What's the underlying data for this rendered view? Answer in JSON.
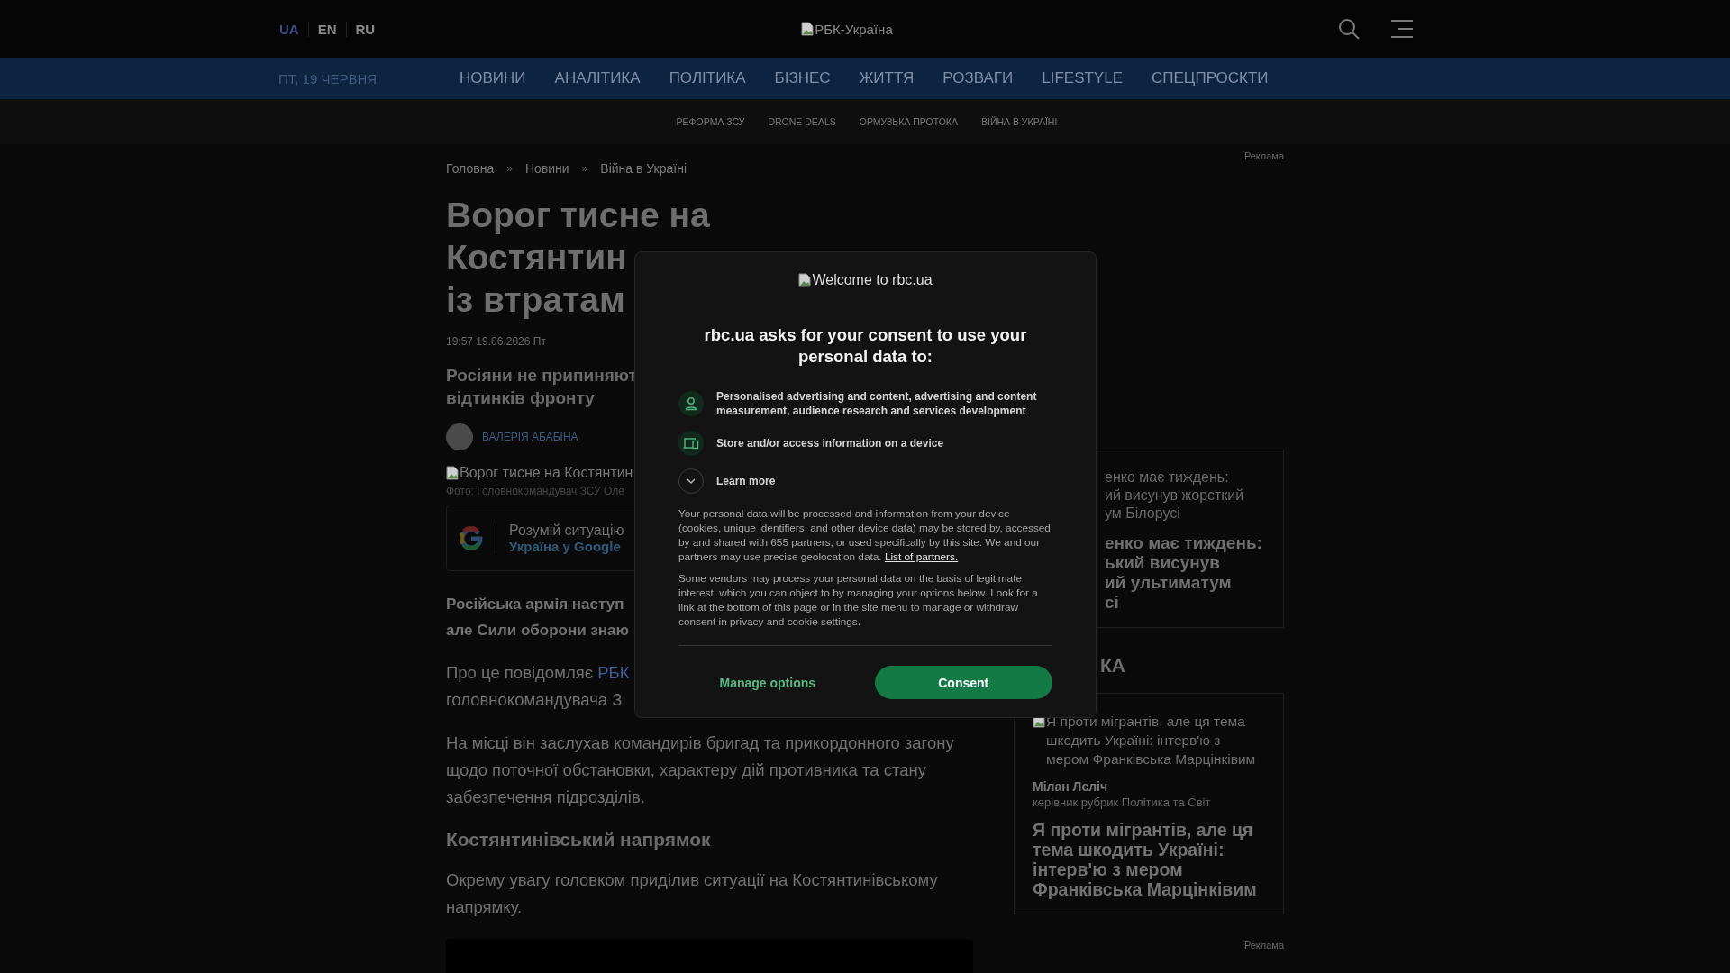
{
  "header": {
    "languages": [
      {
        "label": "UA",
        "selected": true
      },
      {
        "label": "EN",
        "selected": false
      },
      {
        "label": "RU",
        "selected": false
      }
    ],
    "logo_alt": "РБК-Україна"
  },
  "nav": {
    "date": "ПТ, 19 ЧЕРВНЯ",
    "items": [
      "НОВИНИ",
      "АНАЛІТИКА",
      "ПОЛІТИКА",
      "БІЗНЕС",
      "ЖИТТЯ",
      "РОЗВАГИ",
      "LIFESTYLE",
      "СПЕЦПРОЄКТИ"
    ]
  },
  "subnav": [
    "РЕФОРМА ЗСУ",
    "DRONE DEALS",
    "ОРМУЗЬКА ПРОТОКА",
    "ВІЙНА В УКРАЇНІ"
  ],
  "article": {
    "breadcrumbs": [
      {
        "kind": "link",
        "text": "Головна"
      },
      {
        "kind": "sep",
        "text": "»"
      },
      {
        "kind": "link",
        "text": "Новини"
      },
      {
        "kind": "sep",
        "text": "»"
      },
      {
        "kind": "link",
        "text": "Війна в Україні"
      }
    ],
    "title_lines": [
      "Ворог тисне на",
      "Костянтин",
      "із втратам"
    ],
    "published": "19:57 19.06.2026 Пт",
    "lead_lines": [
      "Росіяни не припиняют",
      "відтинків фронту"
    ],
    "author": "ВАЛЕРІЯ АБАБІНА",
    "image": {
      "alt": "Ворог тисне на Костянтин",
      "caption": "Фото: Головнокомандувач ЗСУ Оле"
    },
    "google": {
      "text": "Розумій ситуацію",
      "link": "Україна у Google"
    },
    "body": [
      {
        "kind": "bold",
        "lines": [
          "Російська армія наступ",
          "але Сили оборони знаю"
        ]
      },
      {
        "kind": "source",
        "before": "Про це повідомляє",
        "link": "РБК",
        "lines": [
          "головнокомандувача З"
        ]
      },
      {
        "kind": "para",
        "text": "На місці він заслухав командирів бригад та прикордонного загону щодо поточної обстановки, характеру дій противника та стану забезпечення підрозділів."
      },
      {
        "kind": "heading",
        "text": "Костянтинівський напрямок"
      },
      {
        "kind": "para",
        "text": "Окрему увагу головком приділив ситуації на Костянтинівському напрямку."
      }
    ]
  },
  "sidebar": {
    "ad_label": "Реклама",
    "cut_card": {
      "alt_lines": [
        "енко має тиждень:",
        "ий висунув жорсткий",
        "ум Білорусі"
      ],
      "headline_lines": [
        "енко має тиждень:",
        "ький висунув",
        "ий ультиматум",
        "сі"
      ]
    },
    "section_title": "КА",
    "card": {
      "alt": "Я проти мігрантів, але ця тема шкодить Україні: інтерв'ю з мером Франківська Марцінківим",
      "author": "Мілан Лєліч",
      "role": "керівник рубрик Політика та Світ",
      "headline": "Я проти мігрантів, але ця тема шкодить Україні: інтерв'ю з мером Франківська Марцінківим"
    },
    "bottom_ad_label": "Реклама"
  },
  "consent": {
    "logo_alt": "Welcome to rbc.ua",
    "heading": "rbc.ua asks for your consent to use your personal data to:",
    "purposes": [
      {
        "kind": "person",
        "text": "Personalised advertising and content, advertising and content measurement, audience research and services development"
      },
      {
        "kind": "device",
        "text": "Store and/or access information on a device"
      }
    ],
    "learn_more": {
      "label": "Learn more",
      "expanded": false
    },
    "paragraphs": [
      {
        "text": "Your personal data will be processed and information from your device (cookies, unique identifiers, and other device data) may be stored by, accessed by and shared with 655 partners, or used specifically by this site. We and our partners may use precise geolocation data.",
        "link": "List of partners."
      },
      {
        "text": "Some vendors may process your personal data on the basis of legitimate interest, which you can object to by managing your options below. Look for a link at the bottom of this page or in the site menu to manage or withdraw consent in privacy and cookie settings."
      }
    ],
    "buttons": [
      {
        "kind": "secondary",
        "label": "Manage options"
      },
      {
        "kind": "primary",
        "label": "Consent"
      }
    ]
  }
}
